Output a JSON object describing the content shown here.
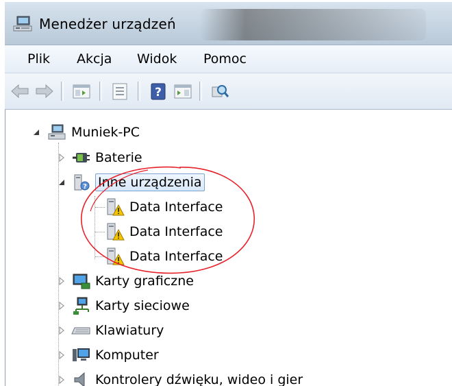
{
  "window": {
    "title": "Menedżer urządzeń",
    "title_icon": "device-manager-icon"
  },
  "menu": {
    "items": [
      {
        "label": "Plik"
      },
      {
        "label": "Akcja"
      },
      {
        "label": "Widok"
      },
      {
        "label": "Pomoc"
      }
    ]
  },
  "toolbar": {
    "buttons": [
      {
        "icon": "back-arrow-icon"
      },
      {
        "icon": "forward-arrow-icon"
      },
      {
        "icon": "show-hide-console-tree-icon"
      },
      {
        "icon": "properties-icon"
      },
      {
        "icon": "help-icon"
      },
      {
        "icon": "show-action-pane-icon"
      },
      {
        "icon": "scan-hardware-changes-icon"
      }
    ]
  },
  "tree": {
    "root": {
      "label": "Muniek-PC",
      "expanded": true,
      "icon": "computer-tree-icon"
    },
    "nodes": [
      {
        "label": "Baterie",
        "icon": "battery-icon",
        "expanded": false
      },
      {
        "label": "Inne urządzenia",
        "icon": "unknown-device-icon",
        "expanded": true,
        "selected": true,
        "children": [
          {
            "label": "Data Interface",
            "icon": "warning-device-icon"
          },
          {
            "label": "Data Interface",
            "icon": "warning-device-icon"
          },
          {
            "label": "Data Interface",
            "icon": "warning-device-icon"
          }
        ]
      },
      {
        "label": "Karty graficzne",
        "icon": "display-adapter-icon",
        "expanded": false
      },
      {
        "label": "Karty sieciowe",
        "icon": "network-adapter-icon",
        "expanded": false
      },
      {
        "label": "Klawiatury",
        "icon": "keyboard-icon",
        "expanded": false
      },
      {
        "label": "Komputer",
        "icon": "computer-icon",
        "expanded": false
      },
      {
        "label": "Kontrolery dźwięku, wideo i gier",
        "icon": "sound-controller-icon",
        "expanded": false
      }
    ]
  },
  "colors": {
    "annotation_circle": "#e8202a",
    "warning": "#f5c400",
    "selection_border": "#7da2ce"
  }
}
